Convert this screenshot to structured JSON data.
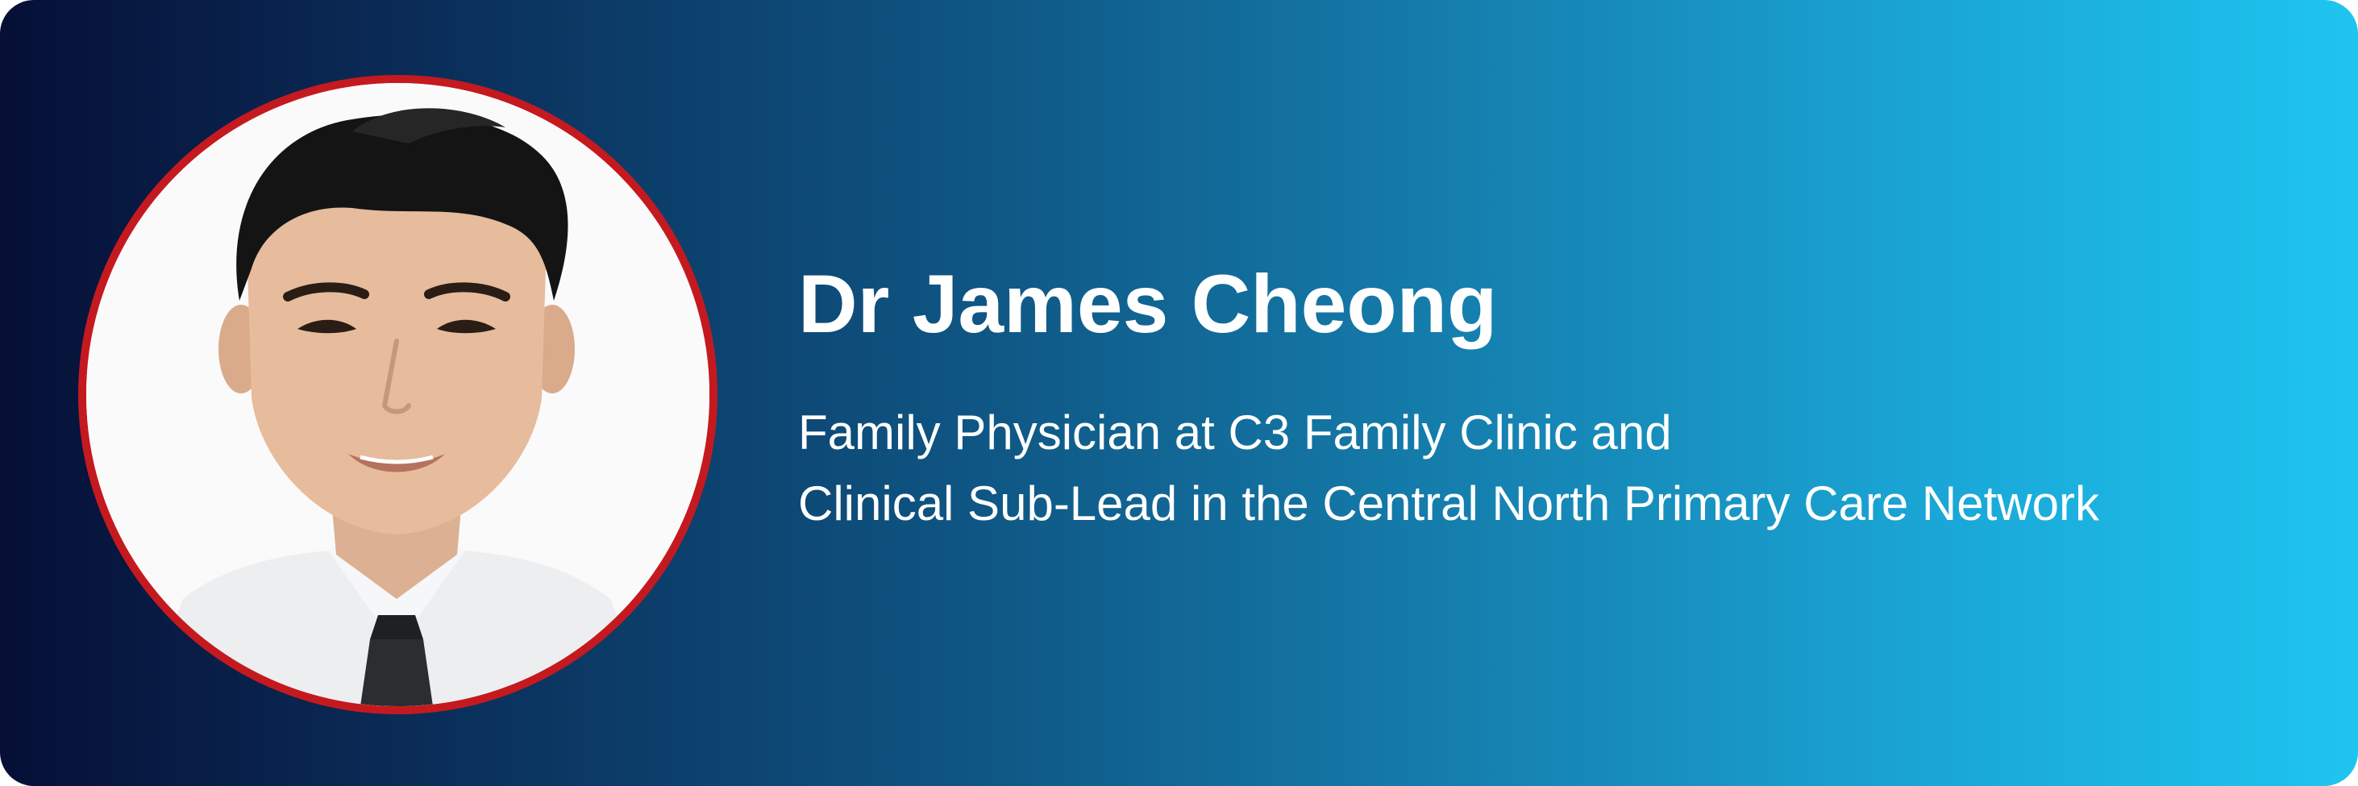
{
  "profile": {
    "name": "Dr James Cheong",
    "role_lines": [
      "Family Physician at C3 Family Clinic and",
      "Clinical Sub-Lead in the Central North Primary Care Network"
    ]
  },
  "colors": {
    "gradient_start": "#060f36",
    "gradient_end": "#1ec5ef",
    "portrait_ring": "#c41a1f",
    "text": "#ffffff"
  }
}
